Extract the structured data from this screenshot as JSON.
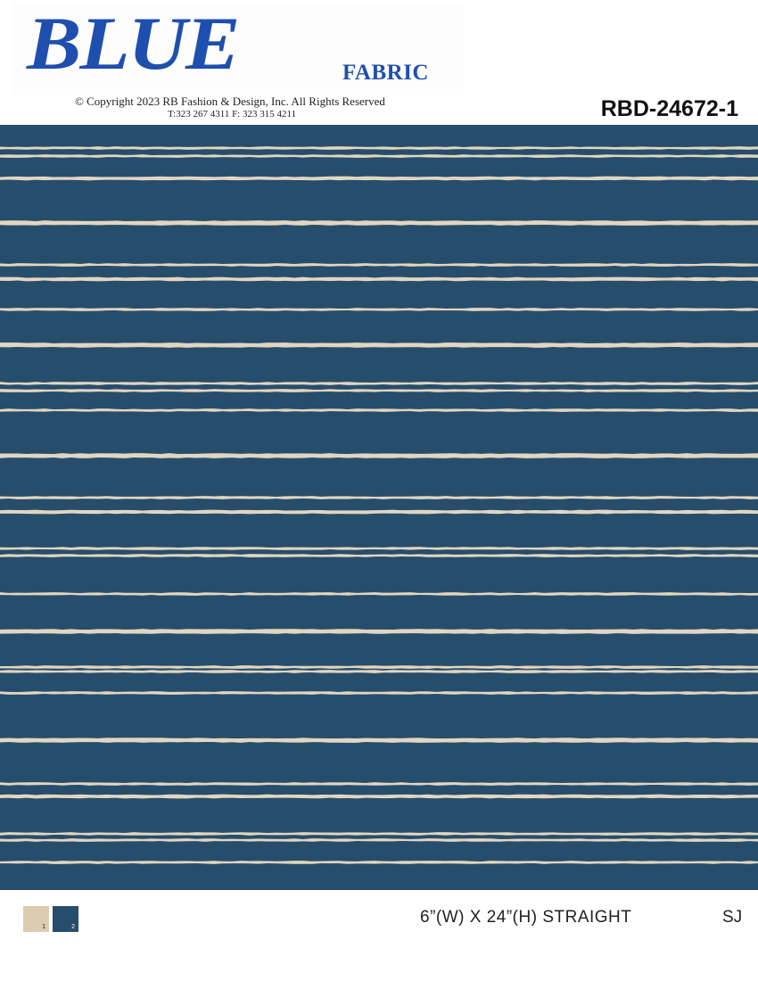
{
  "header": {
    "brand": "BLUE",
    "brand_sub": "FABRIC",
    "copyright": "© Copyright   2023 RB Fashion & Design, Inc. All Rights Reserved",
    "contact": "T:323 267 4311   F: 323 315 4211",
    "design_code": "RBD-24672-1"
  },
  "colors": {
    "ground": "#274d6c",
    "stripe": "#e2d6c0",
    "brand_blue": "#1f4fae"
  },
  "swatches": [
    {
      "index": "1",
      "color": "#dccdb1"
    },
    {
      "index": "2",
      "color": "#274d6c"
    }
  ],
  "footer": {
    "repeat": "6”(W) X 24”(H) STRAIGHT",
    "initials": "SJ"
  }
}
